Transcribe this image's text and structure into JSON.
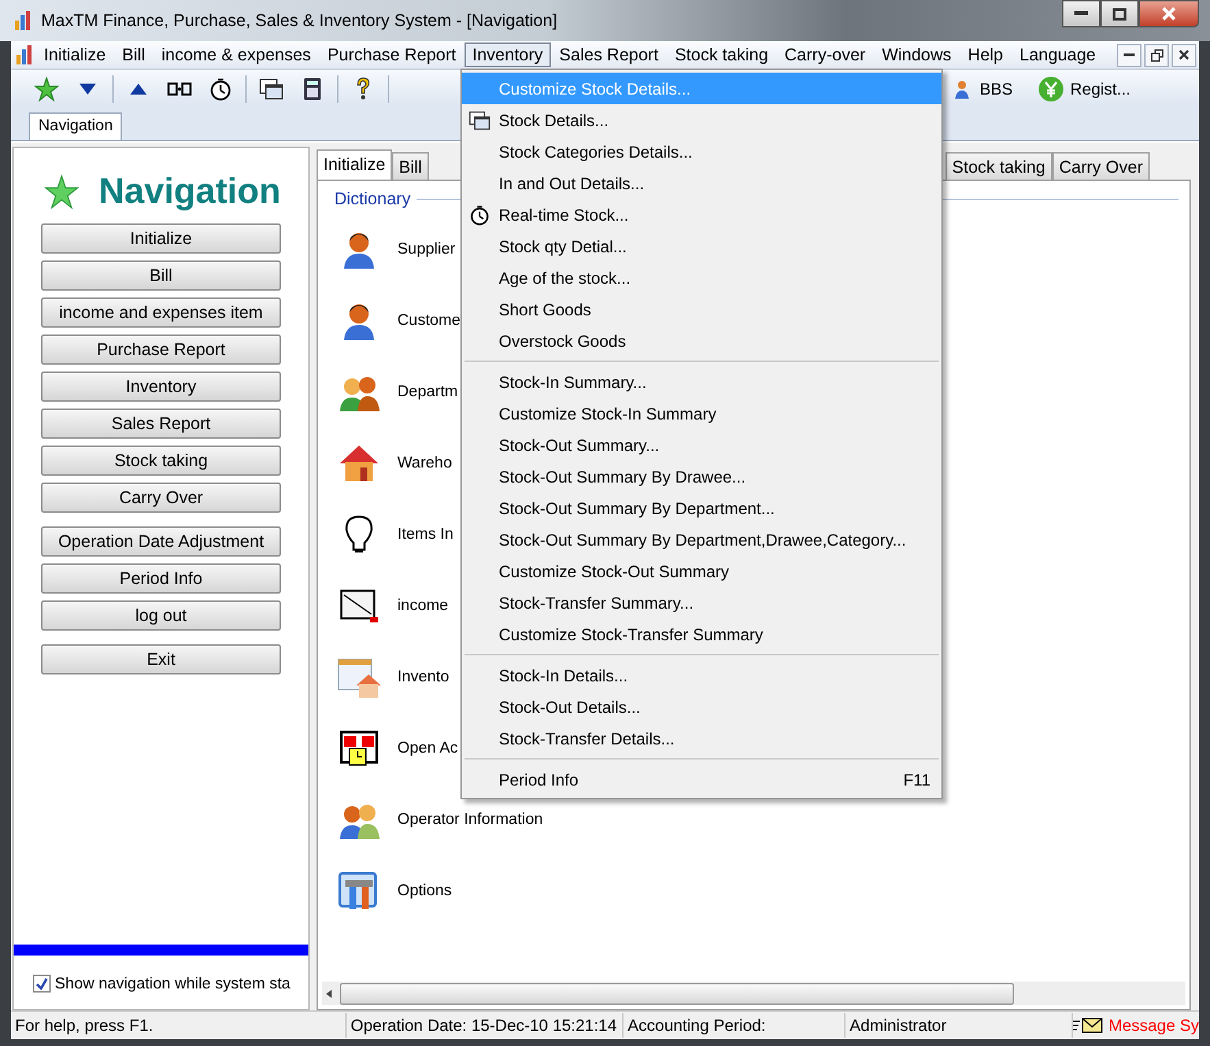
{
  "window": {
    "title": "MaxTM Finance, Purchase, Sales & Inventory System - [Navigation]"
  },
  "menu_bar": [
    {
      "label": "Initialize",
      "selected": false
    },
    {
      "label": "Bill",
      "selected": false
    },
    {
      "label": "income & expenses",
      "selected": false
    },
    {
      "label": "Purchase Report",
      "selected": false
    },
    {
      "label": "Inventory",
      "selected": true
    },
    {
      "label": "Sales Report",
      "selected": false
    },
    {
      "label": "Stock taking",
      "selected": false
    },
    {
      "label": "Carry-over",
      "selected": false
    },
    {
      "label": "Windows",
      "selected": false
    },
    {
      "label": "Help",
      "selected": false
    },
    {
      "label": "Language",
      "selected": false
    }
  ],
  "toolbar": {
    "labeled_buttons": [
      {
        "label": "BBS"
      },
      {
        "label": "Regist..."
      }
    ]
  },
  "document_tabs": [
    {
      "label": "Navigation",
      "selected": true
    }
  ],
  "navigation": {
    "title": "Navigation",
    "button_groups": [
      [
        "Initialize",
        "Bill",
        "income and expenses item",
        "Purchase Report",
        "Inventory",
        "Sales Report",
        "Stock taking",
        "Carry Over"
      ],
      [
        "Operation Date Adjustment",
        "Period Info",
        "log out"
      ],
      [
        "Exit"
      ]
    ],
    "show_on_start": {
      "label": "Show navigation while system sta",
      "checked": true
    }
  },
  "content_tabs": [
    {
      "label": "Initialize",
      "selected": true
    },
    {
      "label": "Bill",
      "selected": false
    },
    {
      "label": "Stock taking",
      "selected": false
    },
    {
      "label": "Carry Over",
      "selected": false
    }
  ],
  "dictionary": {
    "title": "Dictionary",
    "items": [
      "Supplier",
      "Custome",
      "Departm",
      "Wareho",
      "Items In",
      "income",
      "Invento",
      "Open Ac",
      "Operator Information",
      "Options"
    ]
  },
  "inventory_menu": [
    [
      {
        "label": "Customize Stock Details...",
        "selected": true
      },
      {
        "label": "Stock Details...",
        "selected": false
      },
      {
        "label": "Stock Categories Details...",
        "selected": false
      },
      {
        "label": "In and Out Details...",
        "selected": false
      },
      {
        "label": "Real-time Stock...",
        "selected": false
      },
      {
        "label": "Stock qty Detial...",
        "selected": false
      },
      {
        "label": "Age of the stock...",
        "selected": false
      },
      {
        "label": "Short Goods",
        "selected": false
      },
      {
        "label": "Overstock Goods",
        "selected": false
      }
    ],
    [
      {
        "label": "Stock-In Summary...",
        "selected": false
      },
      {
        "label": "Customize Stock-In Summary",
        "selected": false
      },
      {
        "label": "Stock-Out Summary...",
        "selected": false
      },
      {
        "label": "Stock-Out Summary By Drawee...",
        "selected": false
      },
      {
        "label": "Stock-Out Summary By Department...",
        "selected": false
      },
      {
        "label": "Stock-Out Summary By Department,Drawee,Category...",
        "selected": false
      },
      {
        "label": "Customize Stock-Out Summary",
        "selected": false
      },
      {
        "label": "Stock-Transfer Summary...",
        "selected": false
      },
      {
        "label": "Customize Stock-Transfer Summary",
        "selected": false
      }
    ],
    [
      {
        "label": "Stock-In Details...",
        "selected": false
      },
      {
        "label": "Stock-Out Details...",
        "selected": false
      },
      {
        "label": "Stock-Transfer Details...",
        "selected": false
      }
    ],
    [
      {
        "label": "Period Info",
        "selected": false,
        "shortcut": "F11"
      }
    ]
  ],
  "status_bar": [
    "For help, press F1.",
    "Operation Date: 15-Dec-10 15:21:14",
    "Accounting Period:",
    "Administrator",
    "Message Sy"
  ]
}
